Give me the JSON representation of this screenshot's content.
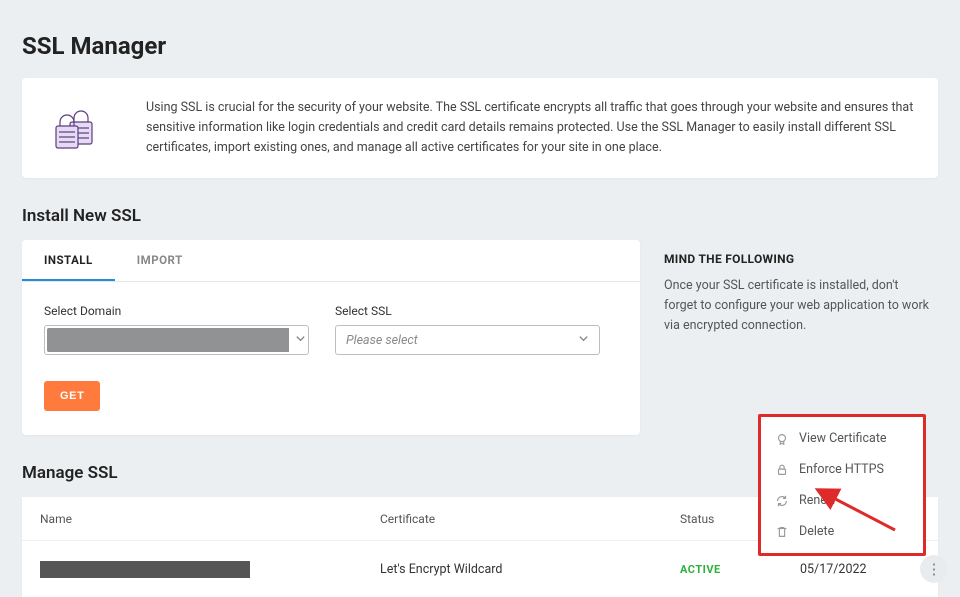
{
  "title": "SSL Manager",
  "info": {
    "text": "Using SSL is crucial for the security of your website. The SSL certificate encrypts all traffic that goes through your website and ensures that sensitive information like login credentials and credit card details remains protected. Use the SSL Manager to easily install different SSL certificates, import existing ones, and manage all active certificates for your site in one place."
  },
  "install": {
    "section_title": "Install New SSL",
    "tabs": {
      "install": "INSTALL",
      "import": "IMPORT"
    },
    "domain_label": "Select Domain",
    "ssl_label": "Select SSL",
    "ssl_placeholder": "Please select",
    "get_label": "GET"
  },
  "side": {
    "heading": "MIND THE FOLLOWING",
    "text": "Once your SSL certificate is installed, don't forget to configure your web application to work via encrypted connection."
  },
  "manage": {
    "section_title": "Manage SSL",
    "columns": {
      "name": "Name",
      "certificate": "Certificate",
      "status": "Status",
      "expires": ""
    },
    "rows": [
      {
        "name": "",
        "certificate": "Let's Encrypt Wildcard",
        "status": "ACTIVE",
        "expires": "05/17/2022"
      }
    ]
  },
  "dropdown": {
    "view": "View Certificate",
    "enforce": "Enforce HTTPS",
    "renew": "Renew",
    "delete": "Delete"
  }
}
